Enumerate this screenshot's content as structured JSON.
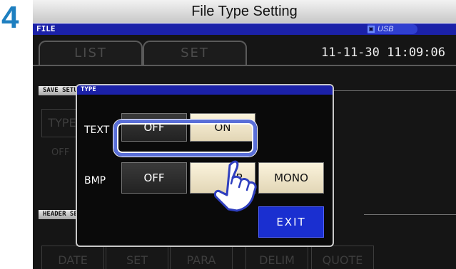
{
  "step_number": "4",
  "title": "File Type Setting",
  "status_bar": {
    "label": "FILE",
    "usb_label": "USB",
    "usb_mark": "▣"
  },
  "tabs": [
    "LIST",
    "SET"
  ],
  "datetime": "11-11-30 11:09:06",
  "sections": {
    "save_setup": "SAVE SETUP",
    "header_setup": "HEADER SETU"
  },
  "background": {
    "type_button": "TYPE",
    "type_value": "OFF",
    "header_buttons": [
      "DATE",
      "SET",
      "PARA",
      "DELIM",
      "QUOTE"
    ]
  },
  "dialog": {
    "title": "TYPE",
    "text_label": "TEXT",
    "text_options": [
      "OFF",
      "ON"
    ],
    "text_selected": "ON",
    "bmp_label": "BMP",
    "bmp_options": [
      "OFF",
      "COLOR",
      "MONO"
    ],
    "bmp_visible": [
      "OFF",
      "OR",
      "MONO"
    ],
    "exit_label": "EXIT"
  },
  "colors": {
    "accent_blue": "#1b21a8",
    "step_blue": "#1e7fc0",
    "highlight": "#5a6fd8",
    "button_light": "#fbf3dc"
  },
  "icons": {
    "pointer": "pointing-hand-icon",
    "usb": "usb-icon"
  }
}
